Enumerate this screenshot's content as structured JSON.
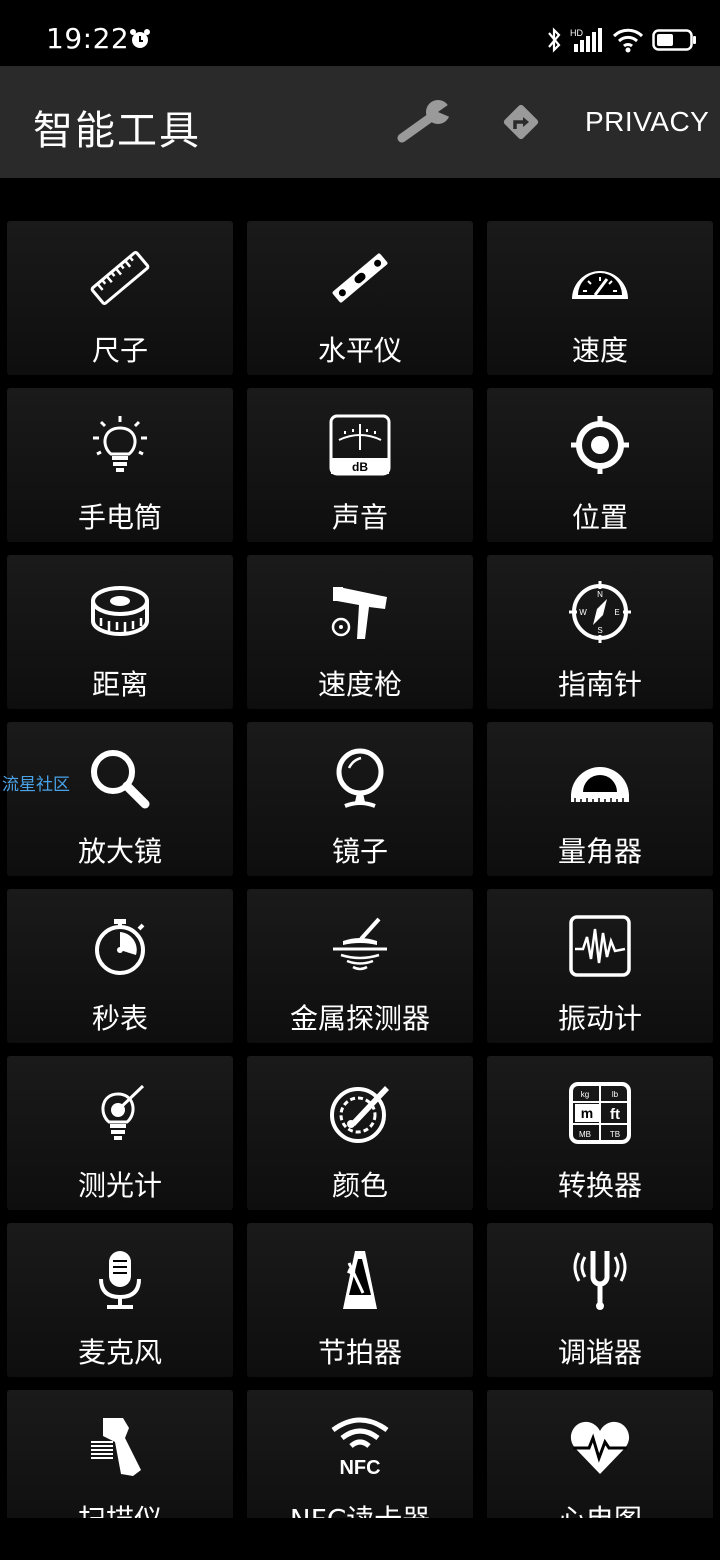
{
  "status_bar": {
    "time": "19:22"
  },
  "app_bar": {
    "title": "智能工具",
    "privacy_label": "PRIVACY"
  },
  "watermark": "流星社区",
  "tools": [
    {
      "label": "尺子",
      "icon": "ruler-icon"
    },
    {
      "label": "水平仪",
      "icon": "level-icon"
    },
    {
      "label": "速度",
      "icon": "speedometer-icon"
    },
    {
      "label": "手电筒",
      "icon": "lightbulb-icon"
    },
    {
      "label": "声音",
      "icon": "db-meter-icon"
    },
    {
      "label": "位置",
      "icon": "gps-target-icon"
    },
    {
      "label": "距离",
      "icon": "tape-measure-icon"
    },
    {
      "label": "速度枪",
      "icon": "radar-gun-icon"
    },
    {
      "label": "指南针",
      "icon": "compass-icon"
    },
    {
      "label": "放大镜",
      "icon": "magnifier-icon"
    },
    {
      "label": "镜子",
      "icon": "mirror-icon"
    },
    {
      "label": "量角器",
      "icon": "protractor-icon"
    },
    {
      "label": "秒表",
      "icon": "stopwatch-icon"
    },
    {
      "label": "金属探测器",
      "icon": "metal-detector-icon"
    },
    {
      "label": "振动计",
      "icon": "vibration-icon"
    },
    {
      "label": "测光计",
      "icon": "light-meter-icon"
    },
    {
      "label": "颜色",
      "icon": "color-palette-icon"
    },
    {
      "label": "转换器",
      "icon": "unit-converter-icon"
    },
    {
      "label": "麦克风",
      "icon": "microphone-icon"
    },
    {
      "label": "节拍器",
      "icon": "metronome-icon"
    },
    {
      "label": "调谐器",
      "icon": "tuning-fork-icon"
    },
    {
      "label": "扫描仪",
      "icon": "barcode-scanner-icon"
    },
    {
      "label": "NFC读卡器",
      "icon": "nfc-icon"
    },
    {
      "label": "心电图",
      "icon": "heart-rate-icon"
    }
  ]
}
